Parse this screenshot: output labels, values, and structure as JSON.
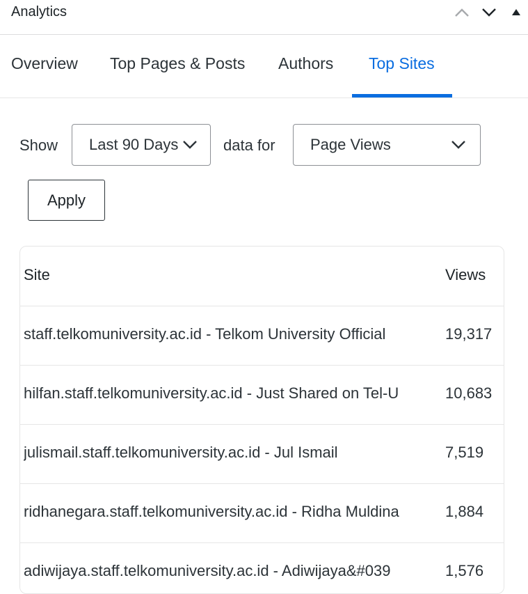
{
  "header": {
    "title": "Analytics"
  },
  "tabs": [
    {
      "label": "Overview"
    },
    {
      "label": "Top Pages & Posts"
    },
    {
      "label": "Authors"
    },
    {
      "label": "Top Sites"
    }
  ],
  "active_tab": "Top Sites",
  "accent_color": "#0a6de0",
  "filters": {
    "show_label": "Show",
    "period": {
      "selected": "Last 90 Days"
    },
    "data_for_label": "data for",
    "metric": {
      "selected": "Page Views"
    }
  },
  "apply_label": "Apply",
  "table": {
    "columns": {
      "site": "Site",
      "views": "Views"
    },
    "rows": [
      {
        "site": "staff.telkomuniversity.ac.id - Telkom University Official",
        "views": "19,317"
      },
      {
        "site": "hilfan.staff.telkomuniversity.ac.id - Just Shared on Tel-U",
        "views": "10,683"
      },
      {
        "site": "julismail.staff.telkomuniversity.ac.id - Jul Ismail",
        "views": "7,519"
      },
      {
        "site": "ridhanegara.staff.telkomuniversity.ac.id - Ridha Muldina",
        "views": "1,884"
      },
      {
        "site": "adiwijaya.staff.telkomuniversity.ac.id - Adiwijaya&#039",
        "views": "1,576"
      }
    ]
  }
}
